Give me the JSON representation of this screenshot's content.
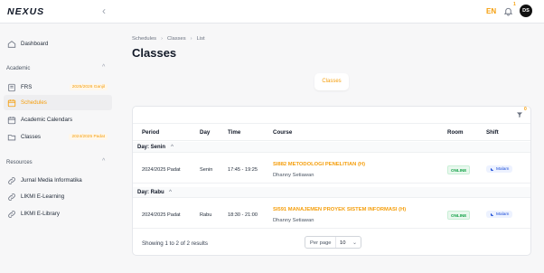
{
  "app": {
    "logo": "NEXUS",
    "language": "EN",
    "notification_count": "1",
    "avatar_initials": "DS"
  },
  "sidebar": {
    "dashboard": "Dashboard",
    "academic_section": "Academic",
    "resources_section": "Resources",
    "academic_items": [
      {
        "label": "FRS",
        "badge": "2025/2026 Ganjil",
        "icon": "document-icon"
      },
      {
        "label": "Schedules",
        "badge": "",
        "icon": "calendar-icon",
        "active": true
      },
      {
        "label": "Academic Calendars",
        "badge": "",
        "icon": "calendar-icon"
      },
      {
        "label": "Classes",
        "badge": "2024/2025 Padat",
        "icon": "folder-icon"
      }
    ],
    "resource_items": [
      {
        "label": "Jurnal Media Informatika",
        "icon": "link-icon"
      },
      {
        "label": "LIKMI E-Learning",
        "icon": "link-icon"
      },
      {
        "label": "LIKMI E-Library",
        "icon": "link-icon"
      }
    ]
  },
  "breadcrumb": [
    "Schedules",
    "Classes",
    "List"
  ],
  "page_title": "Classes",
  "tab": "Classes",
  "filter_count": "0",
  "table": {
    "headers": [
      "Period",
      "Day",
      "Time",
      "Course",
      "Room",
      "Shift"
    ],
    "groups": [
      {
        "label": "Day: Senin",
        "rows": [
          {
            "period": "2024/2025 Padat",
            "day": "Senin",
            "time": "17:45 - 19:25",
            "course": "SI882 METODOLOGI PENELITIAN (H)",
            "lecturer": "Dhanny Setiawan",
            "room": "ONLINE",
            "shift": "Malam"
          }
        ]
      },
      {
        "label": "Day: Rabu",
        "rows": [
          {
            "period": "2024/2025 Padat",
            "day": "Rabu",
            "time": "18:30 - 21:00",
            "course": "SI591 MANAJEMEN PROYEK SISTEM INFORMASI (H)",
            "lecturer": "Dhanny Setiawan",
            "room": "ONLINE",
            "shift": "Malam"
          }
        ]
      }
    ]
  },
  "footer": {
    "results_text": "Showing 1 to 2 of 2 results",
    "per_page_label": "Per page",
    "per_page_value": "10"
  },
  "colors": {
    "accent": "#f59e0b",
    "online": "#16a34a",
    "shift": "#1d4ed8"
  }
}
